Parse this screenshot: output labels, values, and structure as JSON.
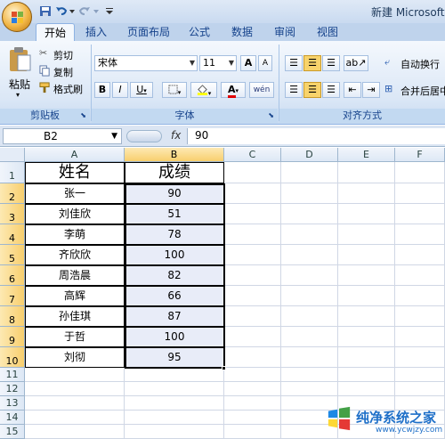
{
  "title": "新建 Microsoft O",
  "tabs": [
    "开始",
    "插入",
    "页面布局",
    "公式",
    "数据",
    "审阅",
    "视图"
  ],
  "clipboard": {
    "paste": "粘贴",
    "cut": "剪切",
    "copy": "复制",
    "format_painter": "格式刷",
    "label": "剪贴板"
  },
  "font": {
    "name": "宋体",
    "size": "11",
    "bold": "B",
    "italic": "I",
    "underline": "U",
    "phonetic": "wén",
    "label": "字体",
    "grow": "A",
    "shrink": "A"
  },
  "alignment": {
    "wrap": "自动换行",
    "merge": "合并后居中",
    "label": "对齐方式"
  },
  "namebox": "B2",
  "fx": "fx",
  "formula": "90",
  "columns": [
    "A",
    "B",
    "C",
    "D",
    "E",
    "F"
  ],
  "rows": [
    "1",
    "2",
    "3",
    "4",
    "5",
    "6",
    "7",
    "8",
    "9",
    "10",
    "11",
    "12",
    "13",
    "14",
    "15"
  ],
  "table": {
    "headers": [
      "姓名",
      "成绩"
    ],
    "names": [
      "张一",
      "刘佳欣",
      "李萌",
      "齐欣欣",
      "周浩晨",
      "高辉",
      "孙佳琪",
      "于哲",
      "刘彻"
    ],
    "scores": [
      "90",
      "51",
      "78",
      "100",
      "82",
      "66",
      "87",
      "100",
      "95"
    ]
  },
  "watermark": {
    "text": "纯净系统之家",
    "url": "www.ycwjzy.com"
  },
  "colors": {
    "accent": "#15428b",
    "selection": "#f8cf6e",
    "ribbon": "#dbe7f6"
  }
}
